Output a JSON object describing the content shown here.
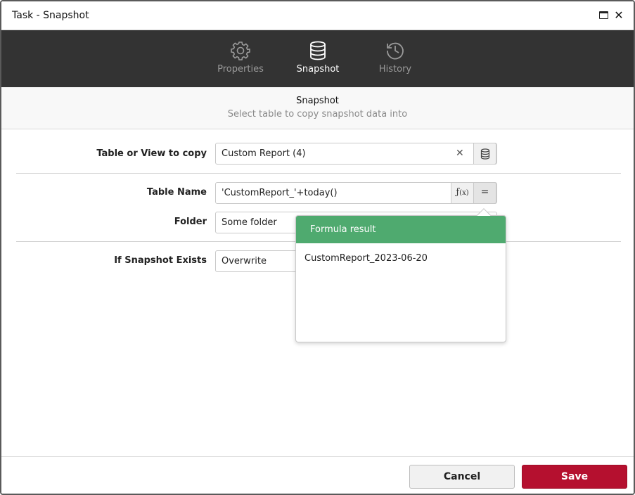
{
  "window": {
    "title": "Task - Snapshot"
  },
  "tabs": [
    {
      "label": "Properties",
      "icon": "gear-icon"
    },
    {
      "label": "Snapshot",
      "icon": "database-icon",
      "active": true
    },
    {
      "label": "History",
      "icon": "history-icon"
    }
  ],
  "section": {
    "title": "Snapshot",
    "subtitle": "Select table to copy snapshot data into"
  },
  "form": {
    "table_or_view": {
      "label": "Table or View to copy",
      "value": "Custom Report (4)"
    },
    "table_name": {
      "label": "Table Name",
      "value": "'CustomReport_'+today()"
    },
    "folder": {
      "label": "Folder",
      "value": "Some folder"
    },
    "if_exists": {
      "label": "If Snapshot Exists",
      "value": "Overwrite"
    }
  },
  "popup": {
    "title": "Formula result",
    "result": "CustomReport_2023-06-20"
  },
  "footer": {
    "cancel_label": "Cancel",
    "save_label": "Save"
  },
  "colors": {
    "tabbar": "#333333",
    "popup_header": "#4faa6f",
    "save_button": "#b5102f"
  }
}
